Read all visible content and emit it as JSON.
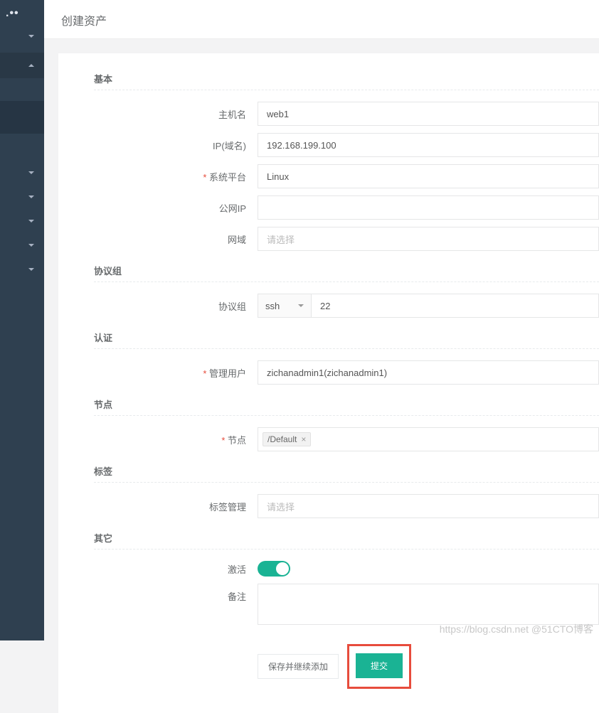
{
  "page": {
    "title": "创建资产"
  },
  "sidebar": {
    "brand_fragment": ".••"
  },
  "sections": {
    "basic": "基本",
    "protocol": "协议组",
    "auth": "认证",
    "node": "节点",
    "labels": "标签",
    "other": "其它"
  },
  "labels": {
    "hostname": "主机名",
    "ip": "IP(域名)",
    "platform": "系统平台",
    "public_ip": "公网IP",
    "domain": "网域",
    "protocol_group": "协议组",
    "admin_user": "管理用户",
    "node": "节点",
    "label_mgmt": "标签管理",
    "active": "激活",
    "comment": "备注"
  },
  "values": {
    "hostname": "web1",
    "ip": "192.168.199.100",
    "platform": "Linux",
    "public_ip": "",
    "domain_placeholder": "请选择",
    "protocol_name": "ssh",
    "protocol_port": "22",
    "admin_user": "zichanadmin1(zichanadmin1)",
    "node_chip": "/Default",
    "label_placeholder": "请选择",
    "comment": ""
  },
  "buttons": {
    "save_continue": "保存并继续添加",
    "submit": "提交"
  },
  "watermark": "https://blog.csdn.net   @51CTO博客"
}
